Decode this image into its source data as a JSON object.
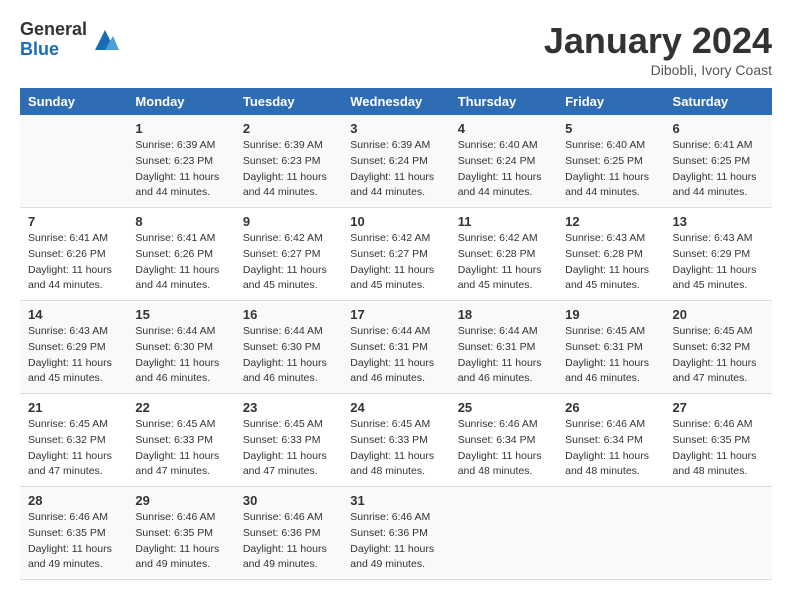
{
  "logo": {
    "general": "General",
    "blue": "Blue"
  },
  "title": {
    "month_year": "January 2024",
    "location": "Dibobli, Ivory Coast"
  },
  "days_of_week": [
    "Sunday",
    "Monday",
    "Tuesday",
    "Wednesday",
    "Thursday",
    "Friday",
    "Saturday"
  ],
  "weeks": [
    [
      {
        "day": "",
        "sunrise": "",
        "sunset": "",
        "daylight": ""
      },
      {
        "day": "1",
        "sunrise": "Sunrise: 6:39 AM",
        "sunset": "Sunset: 6:23 PM",
        "daylight": "Daylight: 11 hours and 44 minutes."
      },
      {
        "day": "2",
        "sunrise": "Sunrise: 6:39 AM",
        "sunset": "Sunset: 6:23 PM",
        "daylight": "Daylight: 11 hours and 44 minutes."
      },
      {
        "day": "3",
        "sunrise": "Sunrise: 6:39 AM",
        "sunset": "Sunset: 6:24 PM",
        "daylight": "Daylight: 11 hours and 44 minutes."
      },
      {
        "day": "4",
        "sunrise": "Sunrise: 6:40 AM",
        "sunset": "Sunset: 6:24 PM",
        "daylight": "Daylight: 11 hours and 44 minutes."
      },
      {
        "day": "5",
        "sunrise": "Sunrise: 6:40 AM",
        "sunset": "Sunset: 6:25 PM",
        "daylight": "Daylight: 11 hours and 44 minutes."
      },
      {
        "day": "6",
        "sunrise": "Sunrise: 6:41 AM",
        "sunset": "Sunset: 6:25 PM",
        "daylight": "Daylight: 11 hours and 44 minutes."
      }
    ],
    [
      {
        "day": "7",
        "sunrise": "Sunrise: 6:41 AM",
        "sunset": "Sunset: 6:26 PM",
        "daylight": "Daylight: 11 hours and 44 minutes."
      },
      {
        "day": "8",
        "sunrise": "Sunrise: 6:41 AM",
        "sunset": "Sunset: 6:26 PM",
        "daylight": "Daylight: 11 hours and 44 minutes."
      },
      {
        "day": "9",
        "sunrise": "Sunrise: 6:42 AM",
        "sunset": "Sunset: 6:27 PM",
        "daylight": "Daylight: 11 hours and 45 minutes."
      },
      {
        "day": "10",
        "sunrise": "Sunrise: 6:42 AM",
        "sunset": "Sunset: 6:27 PM",
        "daylight": "Daylight: 11 hours and 45 minutes."
      },
      {
        "day": "11",
        "sunrise": "Sunrise: 6:42 AM",
        "sunset": "Sunset: 6:28 PM",
        "daylight": "Daylight: 11 hours and 45 minutes."
      },
      {
        "day": "12",
        "sunrise": "Sunrise: 6:43 AM",
        "sunset": "Sunset: 6:28 PM",
        "daylight": "Daylight: 11 hours and 45 minutes."
      },
      {
        "day": "13",
        "sunrise": "Sunrise: 6:43 AM",
        "sunset": "Sunset: 6:29 PM",
        "daylight": "Daylight: 11 hours and 45 minutes."
      }
    ],
    [
      {
        "day": "14",
        "sunrise": "Sunrise: 6:43 AM",
        "sunset": "Sunset: 6:29 PM",
        "daylight": "Daylight: 11 hours and 45 minutes."
      },
      {
        "day": "15",
        "sunrise": "Sunrise: 6:44 AM",
        "sunset": "Sunset: 6:30 PM",
        "daylight": "Daylight: 11 hours and 46 minutes."
      },
      {
        "day": "16",
        "sunrise": "Sunrise: 6:44 AM",
        "sunset": "Sunset: 6:30 PM",
        "daylight": "Daylight: 11 hours and 46 minutes."
      },
      {
        "day": "17",
        "sunrise": "Sunrise: 6:44 AM",
        "sunset": "Sunset: 6:31 PM",
        "daylight": "Daylight: 11 hours and 46 minutes."
      },
      {
        "day": "18",
        "sunrise": "Sunrise: 6:44 AM",
        "sunset": "Sunset: 6:31 PM",
        "daylight": "Daylight: 11 hours and 46 minutes."
      },
      {
        "day": "19",
        "sunrise": "Sunrise: 6:45 AM",
        "sunset": "Sunset: 6:31 PM",
        "daylight": "Daylight: 11 hours and 46 minutes."
      },
      {
        "day": "20",
        "sunrise": "Sunrise: 6:45 AM",
        "sunset": "Sunset: 6:32 PM",
        "daylight": "Daylight: 11 hours and 47 minutes."
      }
    ],
    [
      {
        "day": "21",
        "sunrise": "Sunrise: 6:45 AM",
        "sunset": "Sunset: 6:32 PM",
        "daylight": "Daylight: 11 hours and 47 minutes."
      },
      {
        "day": "22",
        "sunrise": "Sunrise: 6:45 AM",
        "sunset": "Sunset: 6:33 PM",
        "daylight": "Daylight: 11 hours and 47 minutes."
      },
      {
        "day": "23",
        "sunrise": "Sunrise: 6:45 AM",
        "sunset": "Sunset: 6:33 PM",
        "daylight": "Daylight: 11 hours and 47 minutes."
      },
      {
        "day": "24",
        "sunrise": "Sunrise: 6:45 AM",
        "sunset": "Sunset: 6:33 PM",
        "daylight": "Daylight: 11 hours and 48 minutes."
      },
      {
        "day": "25",
        "sunrise": "Sunrise: 6:46 AM",
        "sunset": "Sunset: 6:34 PM",
        "daylight": "Daylight: 11 hours and 48 minutes."
      },
      {
        "day": "26",
        "sunrise": "Sunrise: 6:46 AM",
        "sunset": "Sunset: 6:34 PM",
        "daylight": "Daylight: 11 hours and 48 minutes."
      },
      {
        "day": "27",
        "sunrise": "Sunrise: 6:46 AM",
        "sunset": "Sunset: 6:35 PM",
        "daylight": "Daylight: 11 hours and 48 minutes."
      }
    ],
    [
      {
        "day": "28",
        "sunrise": "Sunrise: 6:46 AM",
        "sunset": "Sunset: 6:35 PM",
        "daylight": "Daylight: 11 hours and 49 minutes."
      },
      {
        "day": "29",
        "sunrise": "Sunrise: 6:46 AM",
        "sunset": "Sunset: 6:35 PM",
        "daylight": "Daylight: 11 hours and 49 minutes."
      },
      {
        "day": "30",
        "sunrise": "Sunrise: 6:46 AM",
        "sunset": "Sunset: 6:36 PM",
        "daylight": "Daylight: 11 hours and 49 minutes."
      },
      {
        "day": "31",
        "sunrise": "Sunrise: 6:46 AM",
        "sunset": "Sunset: 6:36 PM",
        "daylight": "Daylight: 11 hours and 49 minutes."
      },
      {
        "day": "",
        "sunrise": "",
        "sunset": "",
        "daylight": ""
      },
      {
        "day": "",
        "sunrise": "",
        "sunset": "",
        "daylight": ""
      },
      {
        "day": "",
        "sunrise": "",
        "sunset": "",
        "daylight": ""
      }
    ]
  ]
}
